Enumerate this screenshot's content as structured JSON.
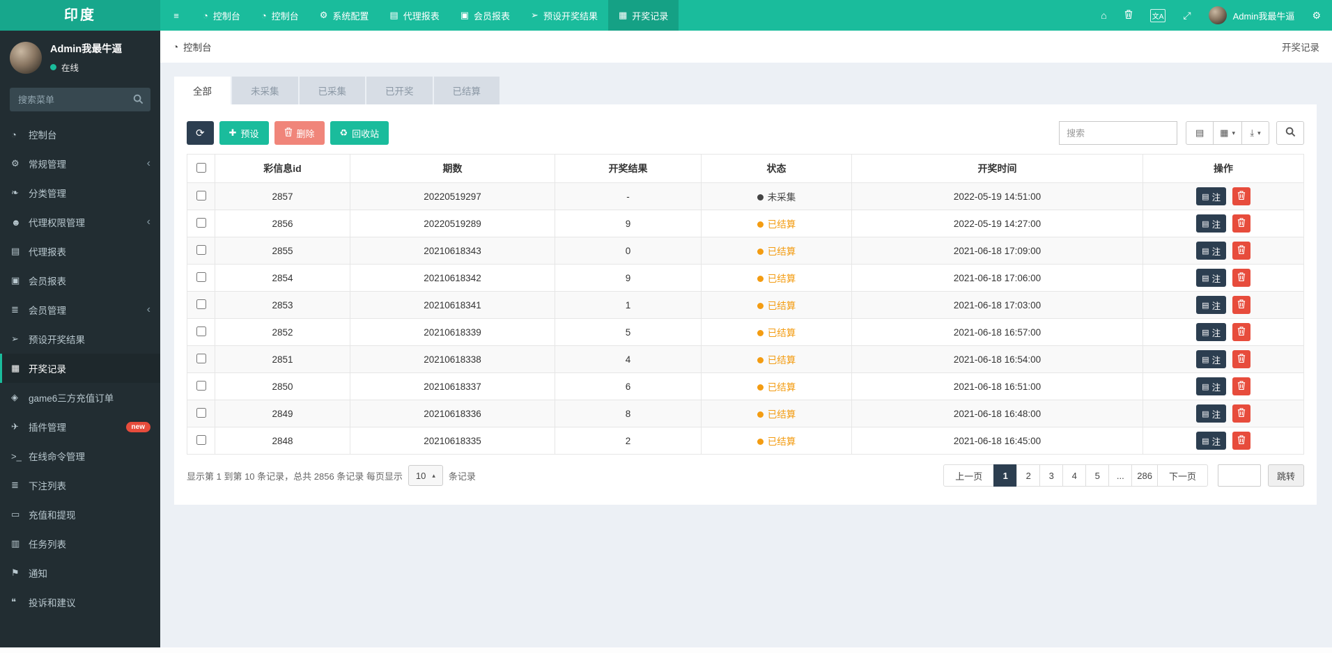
{
  "icons": {
    "menu": "≡",
    "dashboard": "◔",
    "gear": "⚙",
    "gears": "⚙",
    "book": "▤",
    "idcard": "▣",
    "send": "➢",
    "calendar": "▦",
    "gem": "◈",
    "terminal": ">_",
    "list": "≣",
    "money": "▭",
    "tasks": "▥",
    "megaphone": "⚑",
    "support": "❝",
    "leaf": "❧",
    "users": "☻",
    "plane": "✈",
    "home": "⌂",
    "lang": "文A",
    "expand": "⤢",
    "plus": "✚",
    "recycle": "♻",
    "refresh": "⟳",
    "caret_down": "▾",
    "caret_up": "▴",
    "chevron": "‹",
    "grid": "▦",
    "detail": "▤",
    "note": "▤"
  },
  "topbar": {
    "logo": "印度",
    "nav": [
      {
        "label": "控制台",
        "icon": "dashboard"
      },
      {
        "label": "控制台",
        "icon": "dashboard"
      },
      {
        "label": "系统配置",
        "icon": "gear"
      },
      {
        "label": "代理报表",
        "icon": "book"
      },
      {
        "label": "会员报表",
        "icon": "idcard"
      },
      {
        "label": "预设开奖结果",
        "icon": "send"
      },
      {
        "label": "开奖记录",
        "icon": "calendar",
        "active": true
      }
    ],
    "user": "Admin我最牛逼"
  },
  "sidebar": {
    "user": {
      "name": "Admin我最牛逼",
      "status": "在线"
    },
    "search_placeholder": "搜索菜单",
    "items": [
      {
        "label": "控制台",
        "icon": "dashboard"
      },
      {
        "label": "常规管理",
        "icon": "gears",
        "chevron": true
      },
      {
        "label": "分类管理",
        "icon": "leaf"
      },
      {
        "label": "代理权限管理",
        "icon": "users",
        "chevron": true
      },
      {
        "label": "代理报表",
        "icon": "book"
      },
      {
        "label": "会员报表",
        "icon": "idcard"
      },
      {
        "label": "会员管理",
        "icon": "list",
        "chevron": true
      },
      {
        "label": "预设开奖结果",
        "icon": "send"
      },
      {
        "label": "开奖记录",
        "icon": "calendar",
        "active": true
      },
      {
        "label": "game6三方充值订单",
        "icon": "gem"
      },
      {
        "label": "插件管理",
        "icon": "plane",
        "badge": "new"
      },
      {
        "label": "在线命令管理",
        "icon": "terminal"
      },
      {
        "label": "下注列表",
        "icon": "list"
      },
      {
        "label": "充值和提现",
        "icon": "money"
      },
      {
        "label": "任务列表",
        "icon": "tasks"
      },
      {
        "label": "通知",
        "icon": "megaphone"
      },
      {
        "label": "投诉和建议",
        "icon": "support"
      }
    ]
  },
  "content": {
    "breadcrumb": "控制台",
    "page_title": "开奖记录",
    "tabs": [
      {
        "label": "全部",
        "active": true
      },
      {
        "label": "未采集"
      },
      {
        "label": "已采集"
      },
      {
        "label": "已开奖"
      },
      {
        "label": "已结算"
      }
    ],
    "toolbar": {
      "preset_label": "预设",
      "delete_label": "删除",
      "recycle_label": "回收站",
      "search_placeholder": "搜索"
    },
    "table": {
      "columns": [
        "彩信息id",
        "期数",
        "开奖结果",
        "状态",
        "开奖时间",
        "操作"
      ],
      "note_label": "注",
      "rows": [
        {
          "id": "2857",
          "issue": "20220519297",
          "result": "-",
          "status": "未采集",
          "status_type": "pending",
          "time": "2022-05-19 14:51:00"
        },
        {
          "id": "2856",
          "issue": "20220519289",
          "result": "9",
          "status": "已结算",
          "status_type": "settled",
          "time": "2022-05-19 14:27:00"
        },
        {
          "id": "2855",
          "issue": "20210618343",
          "result": "0",
          "status": "已结算",
          "status_type": "settled",
          "time": "2021-06-18 17:09:00"
        },
        {
          "id": "2854",
          "issue": "20210618342",
          "result": "9",
          "status": "已结算",
          "status_type": "settled",
          "time": "2021-06-18 17:06:00"
        },
        {
          "id": "2853",
          "issue": "20210618341",
          "result": "1",
          "status": "已结算",
          "status_type": "settled",
          "time": "2021-06-18 17:03:00"
        },
        {
          "id": "2852",
          "issue": "20210618339",
          "result": "5",
          "status": "已结算",
          "status_type": "settled",
          "time": "2021-06-18 16:57:00"
        },
        {
          "id": "2851",
          "issue": "20210618338",
          "result": "4",
          "status": "已结算",
          "status_type": "settled",
          "time": "2021-06-18 16:54:00"
        },
        {
          "id": "2850",
          "issue": "20210618337",
          "result": "6",
          "status": "已结算",
          "status_type": "settled",
          "time": "2021-06-18 16:51:00"
        },
        {
          "id": "2849",
          "issue": "20210618336",
          "result": "8",
          "status": "已结算",
          "status_type": "settled",
          "time": "2021-06-18 16:48:00"
        },
        {
          "id": "2848",
          "issue": "20210618335",
          "result": "2",
          "status": "已结算",
          "status_type": "settled",
          "time": "2021-06-18 16:45:00"
        }
      ]
    },
    "footer": {
      "summary_prefix": "显示第 1 到第 10 条记录，总共 2856 条记录 每页显示",
      "page_size": "10",
      "summary_suffix": "条记录",
      "pagination": [
        {
          "label": "上一页",
          "type": "prev"
        },
        {
          "label": "1",
          "type": "page",
          "active": true
        },
        {
          "label": "2",
          "type": "page"
        },
        {
          "label": "3",
          "type": "page"
        },
        {
          "label": "4",
          "type": "page"
        },
        {
          "label": "5",
          "type": "page"
        },
        {
          "label": "...",
          "type": "ellipsis"
        },
        {
          "label": "286",
          "type": "page"
        },
        {
          "label": "下一页",
          "type": "next"
        }
      ],
      "jump_label": "跳转"
    }
  }
}
